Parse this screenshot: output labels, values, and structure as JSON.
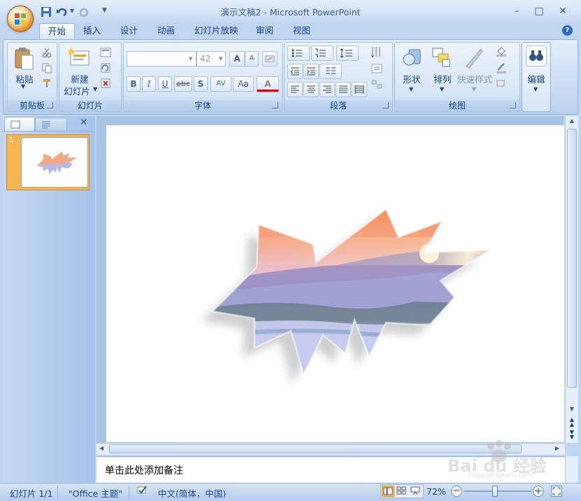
{
  "window": {
    "title": "演示文稿2 - Microsoft PowerPoint",
    "minimize": "–",
    "maximize": "□",
    "close": "✕",
    "help": "?"
  },
  "quick_access": {
    "save_icon": "save-icon",
    "undo_icon": "undo-icon",
    "redo_icon": "redo-icon",
    "customize": "▼"
  },
  "tabs": [
    {
      "label": "开始",
      "active": true
    },
    {
      "label": "插入"
    },
    {
      "label": "设计"
    },
    {
      "label": "动画"
    },
    {
      "label": "幻灯片放映"
    },
    {
      "label": "审阅"
    },
    {
      "label": "视图"
    }
  ],
  "ribbon": {
    "clipboard": {
      "label": "剪贴板",
      "paste": "粘贴"
    },
    "slides": {
      "label": "幻灯片",
      "new_slide_line1": "新建",
      "new_slide_line2": "幻灯片"
    },
    "font": {
      "label": "字体",
      "font_name": "",
      "font_size": "42",
      "bold": "B",
      "italic": "I",
      "underline": "U",
      "strike": "abc",
      "shadow": "S",
      "spacing": "AV",
      "case": "Aa",
      "color": "A",
      "grow": "A",
      "shrink": "A"
    },
    "paragraph": {
      "label": "段落"
    },
    "drawing": {
      "label": "绘图",
      "shapes": "形状",
      "arrange": "排列",
      "quick_styles": "快速样式"
    },
    "editing": {
      "label": "编辑"
    }
  },
  "slides_pane": {
    "slide_number": "1",
    "close": "✕"
  },
  "notes": {
    "placeholder": "单击此处添加备注"
  },
  "status_bar": {
    "slide_info": "幻灯片 1/1",
    "theme": "\"Office 主题\"",
    "language": "中文(简体，中国)",
    "zoom": "72%",
    "zoom_level": 0.46
  },
  "watermark": {
    "text": "Bai du 经验",
    "url": "jingyan.baidu.com"
  }
}
